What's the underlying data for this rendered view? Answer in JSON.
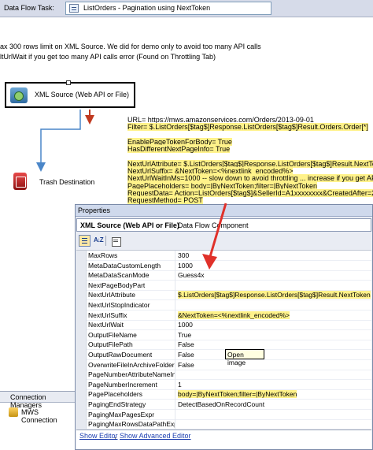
{
  "header": {
    "task_label": "Data Flow Task:",
    "task_value": "ListOrders - Pagination using NextToken"
  },
  "notes": [
    "ax 300 rows limit on XML Source. We did for demo only to avoid too many API calls",
    "ltUrlWait if you get too many API calls error (Found on Throttling Tab)"
  ],
  "nodes": {
    "xml_source": "XML Source (Web API or File)",
    "trash": "Trash Destination"
  },
  "source_props": [
    {
      "text": "URL=  https://mws.amazonservices.com/Orders/2013-09-01",
      "highlight": false
    },
    {
      "text": "Filter=  $.ListOrders[$tag$]Response.ListOrders[$tag$]Result.Orders.Order[*]",
      "highlight": true
    },
    {
      "text": "",
      "highlight": false
    },
    {
      "text": "EnablePageTokenForBody=  True",
      "highlight": true
    },
    {
      "text": "HasDifferentNextPageInfo=  True",
      "highlight": true
    },
    {
      "text": "",
      "highlight": false
    },
    {
      "text": "NextUrlAttribute=  $.ListOrders[$tag$]Response.ListOrders[$tag$]Result.NextToken",
      "highlight": true
    },
    {
      "text": "NextUrlSuffix=  &NextToken=<%nextlink_encoded%>",
      "highlight": true
    },
    {
      "text": "NextUrlWaitInMs=1000 -- slow down to avoid throttling ... increase if you get API Limi",
      "highlight": true
    },
    {
      "text": "PagePlaceholders=  body=|ByNextToken;filter=|ByNextToken",
      "highlight": true
    },
    {
      "text": "RequestData=  Action=ListOrders[$tag$]&SellerId=A1xxxxxxxx&CreatedAfter=2018-",
      "highlight": true
    },
    {
      "text": "RequestMethod=  POST",
      "highlight": true
    }
  ],
  "properties": {
    "title": "Properties",
    "object_name": "XML Source (Web API or File)",
    "object_type": "Data Flow Component",
    "toolbar": {
      "categorized_icon": "categorized-icon",
      "alphabetical_glyph": "A↓Z",
      "property_pages_icon": "property-pages-icon"
    },
    "rows": [
      {
        "name": "MaxRows",
        "value": "300",
        "highlight": false
      },
      {
        "name": "MetaDataCustomLength",
        "value": "1000",
        "highlight": false
      },
      {
        "name": "MetaDataScanMode",
        "value": "Guess4x",
        "highlight": false
      },
      {
        "name": "NextPageBodyPart",
        "value": "",
        "highlight": false
      },
      {
        "name": "NextUrlAttribute",
        "value": "$.ListOrders[$tag$]Response.ListOrders[$tag$]Result.NextToken",
        "highlight": true
      },
      {
        "name": "NextUrlStopIndicator",
        "value": "",
        "highlight": false
      },
      {
        "name": "NextUrlSuffix",
        "value": "&NextToken=<%nextlink_encoded%>",
        "highlight": true
      },
      {
        "name": "NextUrlWait",
        "value": "1000",
        "highlight": false
      },
      {
        "name": "OutputFileName",
        "value": "True",
        "highlight": false
      },
      {
        "name": "OutputFilePath",
        "value": "False",
        "highlight": false
      },
      {
        "name": "OutputRawDocument",
        "value": "False",
        "highlight": false
      },
      {
        "name": "OverwriteFileInArchiveFolder",
        "value": "False",
        "highlight": false
      },
      {
        "name": "PageNumberAttributeNameInL",
        "value": "",
        "highlight": false
      },
      {
        "name": "PageNumberIncrement",
        "value": "1",
        "highlight": false
      },
      {
        "name": "PagePlaceholders",
        "value": "body=|ByNextToken;filter=|ByNextToken",
        "highlight": true
      },
      {
        "name": "PagingEndStrategy",
        "value": "DetectBasedOnRecordCount",
        "highlight": false
      },
      {
        "name": "PagingMaxPagesExpr",
        "value": "",
        "highlight": false
      },
      {
        "name": "PagingMaxRowsDataPathExpr",
        "value": "",
        "highlight": false
      }
    ],
    "links": {
      "show_editor": "Show Editor",
      "separator": ",",
      "show_advanced_editor": "Show Advanced Editor"
    },
    "tooltip": "Open image"
  },
  "connection_managers": {
    "title": "Connection Managers",
    "items": [
      {
        "label": "MWS Connection"
      }
    ]
  },
  "colors": {
    "highlight": "#fff28a",
    "accent_red": "#e0312a",
    "link": "#1c3fb0",
    "connector": "#4a86c8"
  }
}
